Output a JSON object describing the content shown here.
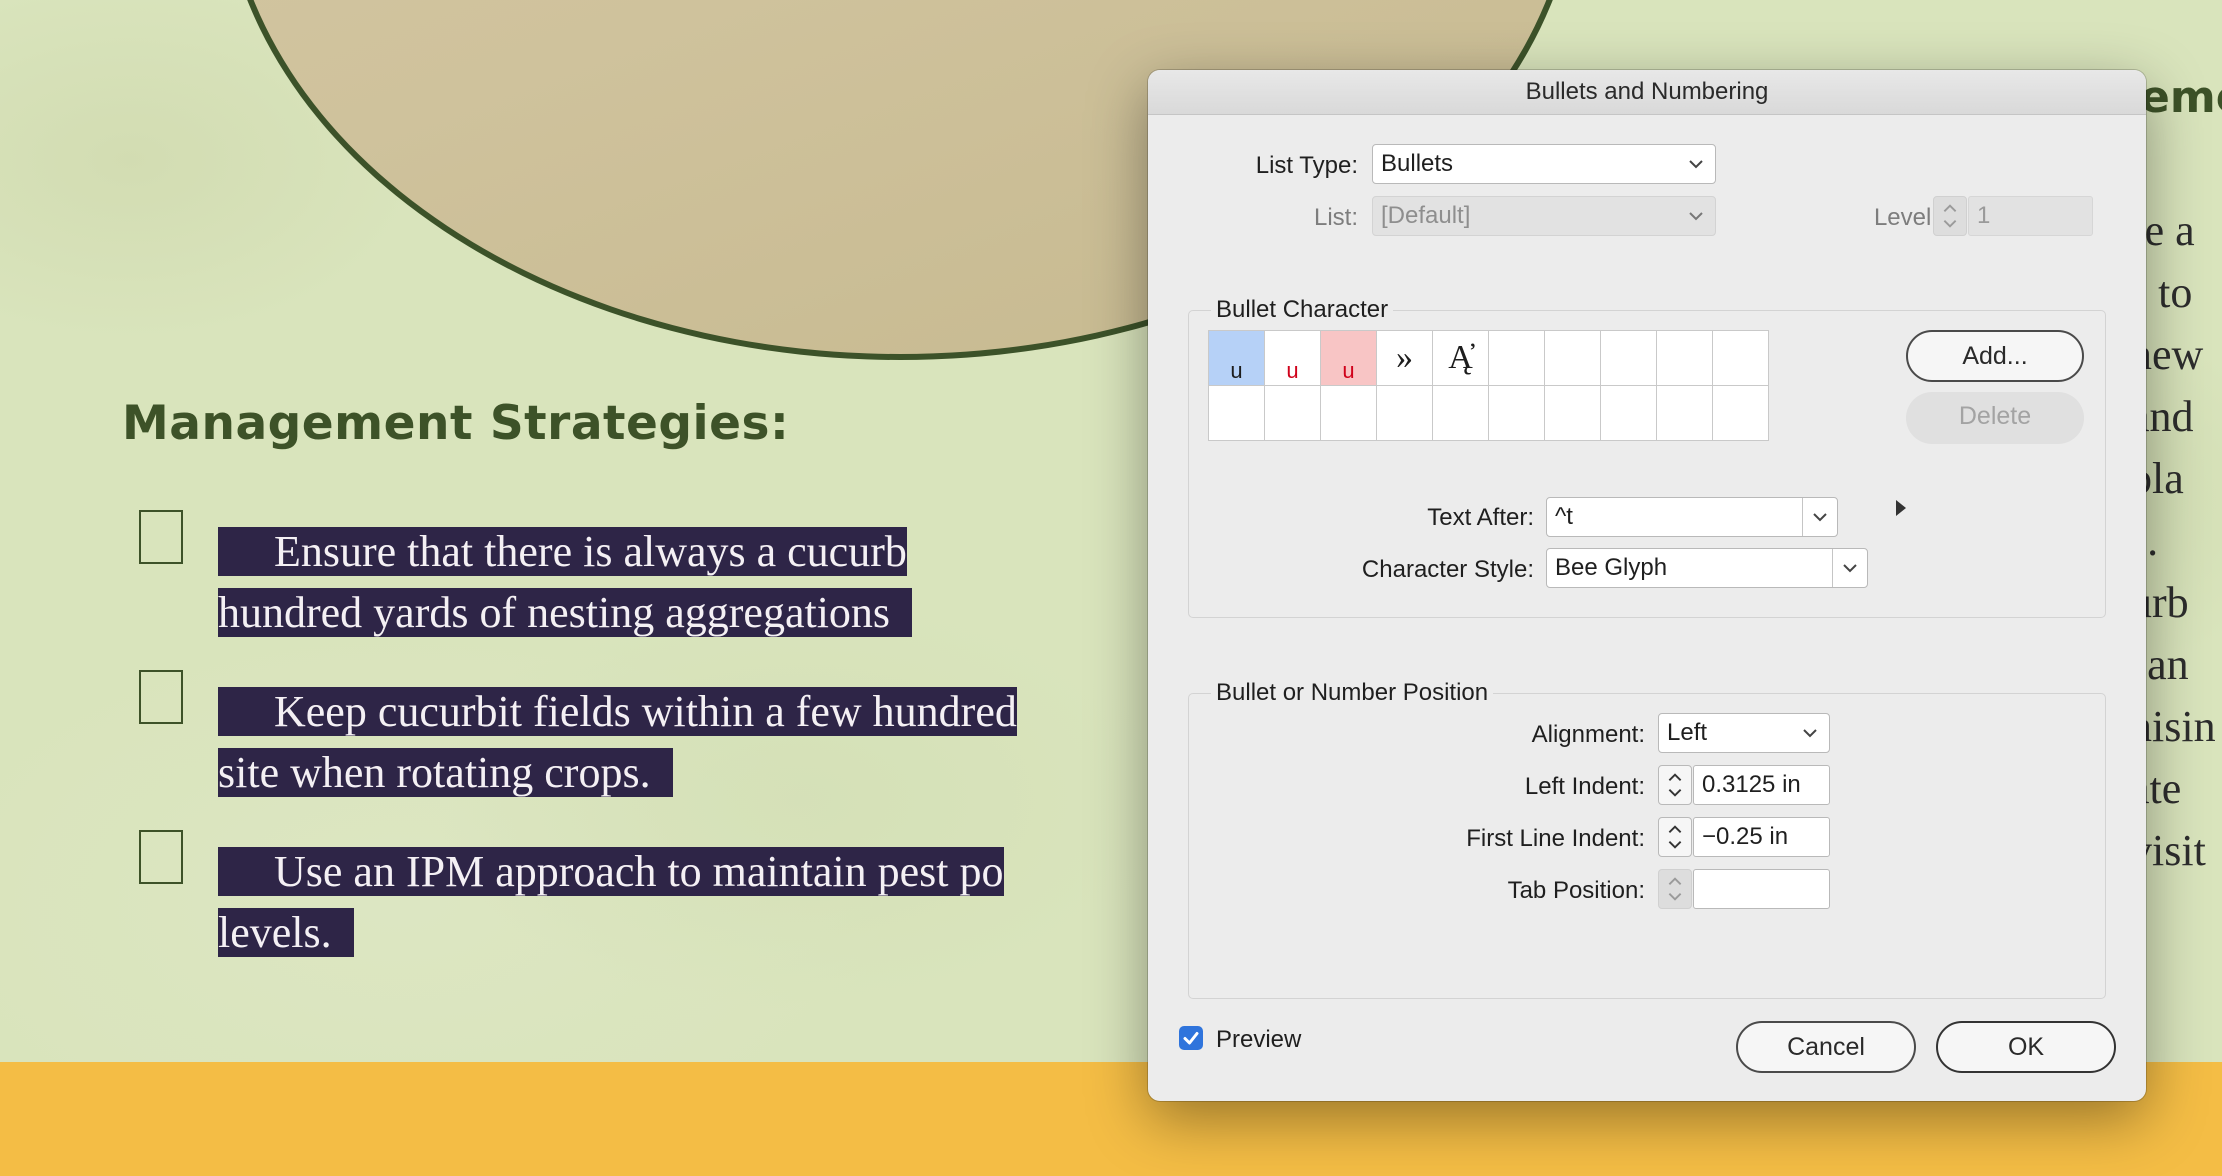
{
  "document": {
    "heading": "Management Strategies:",
    "list_items": [
      {
        "line1": "Ensure that there is always a cucurb",
        "line2": "hundred yards of nesting aggregations "
      },
      {
        "line1": "Keep cucurbit fields within a few hundred",
        "line2": "site when rotating crops. "
      },
      {
        "line1": "Use an IPM approach to maintain pest po",
        "line2": "levels. "
      }
    ],
    "right_heading_fragment": "eme",
    "right_fragments": [
      "re a",
      "s to",
      "new",
      "and",
      "bla",
      "s.",
      "urb",
      "san",
      "nisin",
      "ate",
      "visit"
    ]
  },
  "dialog": {
    "title": "Bullets and Numbering",
    "list_type": {
      "label": "List Type:",
      "value": "Bullets"
    },
    "list": {
      "label": "List:",
      "value": "[Default]"
    },
    "level": {
      "label": "Level:",
      "value": "1"
    },
    "bullet_character": {
      "title": "Bullet Character",
      "glyphs": [
        {
          "char": "u",
          "bg": "#b6d1f7",
          "color": "#1d1d1d",
          "big": false
        },
        {
          "char": "u",
          "bg": "#ffffff",
          "color": "#d0021b",
          "big": false
        },
        {
          "char": "u",
          "bg": "#f8c5c5",
          "color": "#d0021b",
          "big": false
        },
        {
          "char": "»",
          "bg": "#ffffff",
          "color": "#1d1d1d",
          "big": true
        },
        {
          "char": "Ą̓",
          "bg": "#ffffff",
          "color": "#1d1d1d",
          "big": true
        }
      ],
      "add_button": "Add...",
      "delete_button": "Delete",
      "text_after": {
        "label": "Text After:",
        "value": "^t"
      },
      "character_style": {
        "label": "Character Style:",
        "value": "Bee Glyph"
      }
    },
    "position": {
      "title": "Bullet or Number Position",
      "alignment": {
        "label": "Alignment:",
        "value": "Left"
      },
      "left_indent": {
        "label": "Left Indent:",
        "value": "0.3125 in"
      },
      "first_line_indent": {
        "label": "First Line Indent:",
        "value": "−0.25 in"
      },
      "tab_position": {
        "label": "Tab Position:",
        "value": ""
      }
    },
    "preview": {
      "label": "Preview",
      "checked": true
    },
    "cancel_button": "Cancel",
    "ok_button": "OK"
  },
  "colors": {
    "accent": "#2f74dc",
    "selection_bg": "#2e2547",
    "heading_green": "#3d5228",
    "footer_yellow": "#f4bd45"
  }
}
